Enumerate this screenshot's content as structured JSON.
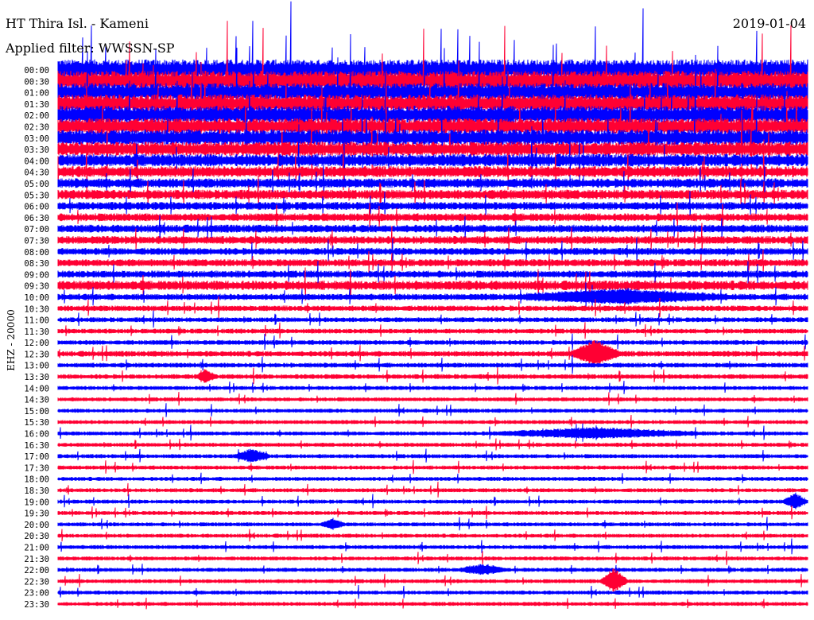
{
  "header": {
    "title": "HT Thira Isl. - Kameni",
    "filter": "Applied filter: WWSSN-SP",
    "date": "2019-01-04"
  },
  "chart_data": {
    "type": "line",
    "subtype": "helicorder",
    "title": "HT Thira Isl. - Kameni",
    "ylabel": "EHZ - 20000",
    "xlabel": "",
    "minutes_per_line": 30,
    "colors": [
      "#0000ff",
      "#ff0033"
    ],
    "lines": [
      "00:00",
      "00:30",
      "01:00",
      "01:30",
      "02:00",
      "02:30",
      "03:00",
      "03:30",
      "04:00",
      "04:30",
      "05:00",
      "05:30",
      "06:00",
      "06:30",
      "07:00",
      "07:30",
      "08:00",
      "08:30",
      "09:00",
      "09:30",
      "10:00",
      "10:30",
      "11:00",
      "11:30",
      "12:00",
      "12:30",
      "13:00",
      "13:30",
      "14:00",
      "14:30",
      "15:00",
      "15:30",
      "16:00",
      "16:30",
      "17:00",
      "17:30",
      "18:00",
      "18:30",
      "19:00",
      "19:30",
      "20:00",
      "20:30",
      "21:00",
      "21:30",
      "22:00",
      "22:30",
      "23:00",
      "23:30"
    ],
    "noise_level": [
      12,
      12,
      11,
      11,
      11,
      10,
      10,
      9,
      8,
      7,
      6,
      6,
      5,
      5,
      5,
      5,
      4.5,
      4.5,
      4.5,
      6,
      4,
      3.5,
      3,
      3,
      3,
      3.5,
      3,
      3,
      2.5,
      2.5,
      2.5,
      2.5,
      2.5,
      2.5,
      2.5,
      2.5,
      2.5,
      2.5,
      2.5,
      2.5,
      2.5,
      2.5,
      2.5,
      2.5,
      2.5,
      2.5,
      2.5,
      2.5
    ],
    "events": [
      {
        "line": "10:00",
        "start_min": 18,
        "end_min": 27,
        "amplitude": 8
      },
      {
        "line": "12:30",
        "start_min": 20.5,
        "end_min": 22.5,
        "amplitude": 16
      },
      {
        "line": "16:00",
        "start_min": 17,
        "end_min": 26,
        "amplitude": 6
      },
      {
        "line": "17:00",
        "start_min": 7,
        "end_min": 8.5,
        "amplitude": 8
      },
      {
        "line": "19:00",
        "start_min": 29,
        "end_min": 30,
        "amplitude": 10
      },
      {
        "line": "20:00",
        "start_min": 10.5,
        "end_min": 11.5,
        "amplitude": 6
      },
      {
        "line": "22:00",
        "start_min": 16,
        "end_min": 18,
        "amplitude": 6
      },
      {
        "line": "22:30",
        "start_min": 21.7,
        "end_min": 22.8,
        "amplitude": 16
      },
      {
        "line": "13:30",
        "start_min": 5.5,
        "end_min": 6.3,
        "amplitude": 8
      }
    ]
  }
}
